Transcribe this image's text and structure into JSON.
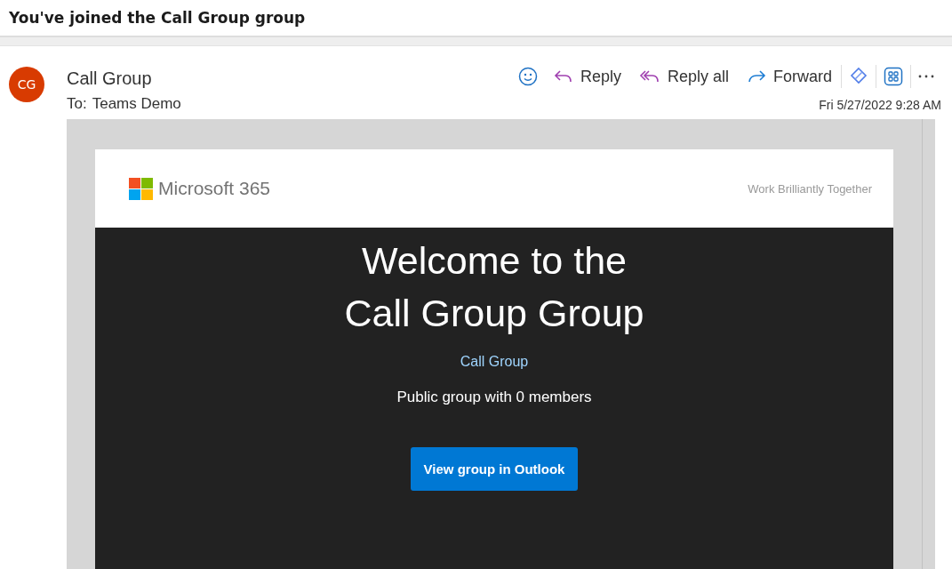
{
  "subject": "You've joined the Call Group group",
  "message": {
    "avatar_initials": "CG",
    "sender": "Call Group",
    "to_label": "To:",
    "to": "Teams Demo",
    "date": "Fri 5/27/2022 9:28 AM",
    "actions": [
      {
        "kind": "emoji"
      },
      {
        "kind": "reply",
        "label": "Reply"
      },
      {
        "kind": "reply_all",
        "label": "Reply all"
      },
      {
        "kind": "forward",
        "label": "Forward"
      },
      {
        "kind": "divider"
      },
      {
        "kind": "loop"
      },
      {
        "kind": "divider"
      },
      {
        "kind": "apps"
      },
      {
        "kind": "divider"
      },
      {
        "kind": "more"
      }
    ]
  },
  "email": {
    "brand": "Microsoft 365",
    "tagline": "Work Brilliantly Together",
    "heading": [
      "Welcome to the",
      "Call Group Group"
    ],
    "group_link": "Call Group",
    "description": "Public group with 0 members",
    "button": "View group in Outlook"
  }
}
